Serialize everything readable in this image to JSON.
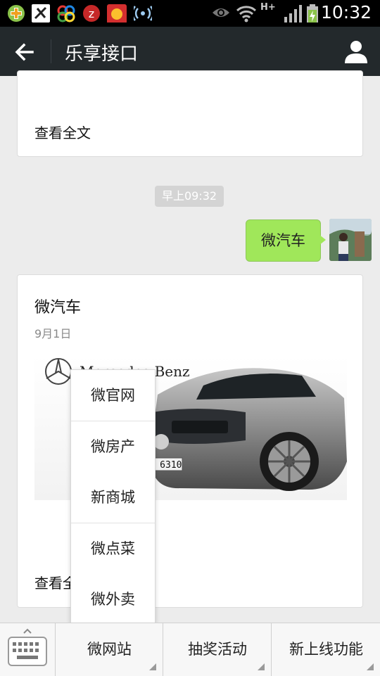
{
  "status_bar": {
    "time": "10:32",
    "network": "H+",
    "icons": [
      "app-plus-icon",
      "app-x-icon",
      "app-loop-icon",
      "app-z-icon",
      "app-red-icon",
      "signal-icon",
      "eye-icon",
      "wifi-icon",
      "cell-signal-icon",
      "battery-icon"
    ]
  },
  "app_bar": {
    "title": "乐享接口",
    "icons": [
      "back-arrow-icon",
      "person-icon"
    ]
  },
  "chat": {
    "top_card": {
      "read_more": "查看全文"
    },
    "timestamp": "早上09:32",
    "sent_message": "微汽车",
    "news_card": {
      "title": "微汽车",
      "date": "9月1日",
      "brand": "Mercedes-Benz",
      "plate": "A 6310",
      "read_more": "查看全文"
    }
  },
  "popup_menu": {
    "items": [
      "微官网",
      "微房产",
      "新商城",
      "微点菜",
      "微外卖"
    ]
  },
  "bottom_bar": {
    "keyboard_icon": "keyboard-icon",
    "menus": [
      "微网站",
      "抽奖活动",
      "新上线功能"
    ]
  },
  "colors": {
    "app_bar_bg": "#23292c",
    "bubble_green": "#a0e75a",
    "background": "#ececec"
  }
}
